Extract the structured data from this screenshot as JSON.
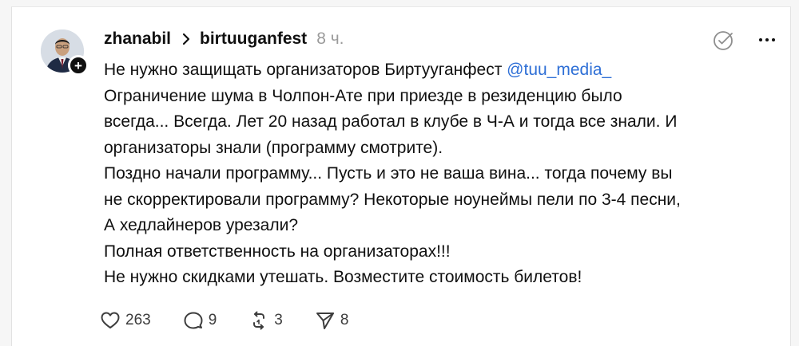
{
  "post": {
    "username": "zhanabil",
    "community": "birtuuganfest",
    "timestamp": "8 ч.",
    "line_1_text": "Не нужно защищать организаторов Биртууганфест ",
    "mention": "@tuu_media_",
    "lines": [
      "Ограничение шума в Чолпон-Ате при приезде в резиденцию было",
      "всегда... Всегда. Лет 20 назад работал в клубе в Ч-А и тогда все знали. И",
      "организаторы знали (программу смотрите).",
      "Поздно начали программу... Пусть и это не ваша вина... тогда почему вы",
      "не скорректировали программу? Некоторые ноунеймы пели по 3-4 песни,",
      "А хедлайнеров урезали?",
      "Полная ответственность на организаторах!!!",
      "Не нужно скидками утешать. Возместите стоимость билетов!"
    ]
  },
  "actions": {
    "likes": "263",
    "replies": "9",
    "reposts": "3",
    "shares": "8"
  },
  "colors": {
    "text": "#101010",
    "muted": "#9a9a9a",
    "mention": "#2e6fd6",
    "background": "#f6f6f6",
    "card": "#ffffff"
  }
}
